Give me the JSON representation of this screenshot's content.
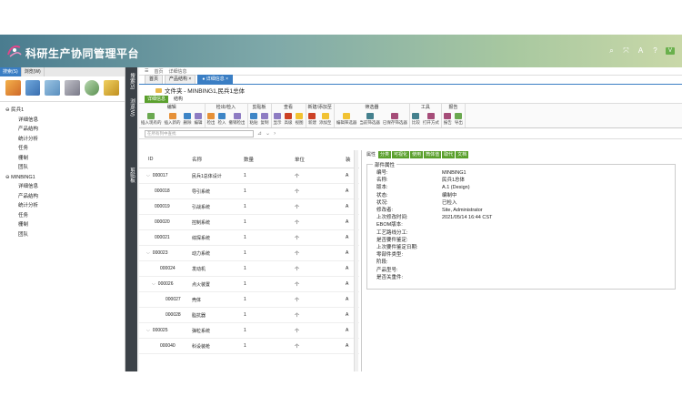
{
  "header": {
    "title": "科研生产协同管理平台",
    "user": "V"
  },
  "left": {
    "tabs": [
      "搜索(S)",
      "浏览(W)"
    ],
    "tree": [
      {
        "label": "⊖ 民兵1",
        "level": 0
      },
      {
        "label": "详细信息",
        "level": 2
      },
      {
        "label": "产品结构",
        "level": 2
      },
      {
        "label": "统计分析",
        "level": 2
      },
      {
        "label": "任务",
        "level": 2
      },
      {
        "label": "栅制",
        "level": 2
      },
      {
        "label": "团队",
        "level": 2
      },
      {
        "label": "⊖ MINBING1",
        "level": 0
      },
      {
        "label": "详细信息",
        "level": 2
      },
      {
        "label": "产品结构",
        "level": 2
      },
      {
        "label": "统计分析",
        "level": 2
      },
      {
        "label": "任务",
        "level": 2
      },
      {
        "label": "栅制",
        "level": 2
      },
      {
        "label": "团队",
        "level": 2
      }
    ]
  },
  "vbar": {
    "labels": [
      "搜索(S)",
      "浏览(W)",
      "剪贴板"
    ]
  },
  "main": {
    "top": [
      "首页",
      "详细信息"
    ],
    "tabs": [
      "首页",
      "产品结构 ×",
      "● 详细信息 ×"
    ],
    "breadcrumb": "文件夹 - MINBING1,民兵1总体",
    "subtabs": [
      "详细信息",
      "结构"
    ],
    "ribbon": [
      {
        "title": "编辑",
        "items": [
          "插入现有的",
          "插入新的",
          "删除",
          "编辑"
        ]
      },
      {
        "title": "检出/检入",
        "items": [
          "检出",
          "检入",
          "撤销检出"
        ]
      },
      {
        "title": "剪贴板",
        "items": [
          "粘贴",
          "复制"
        ]
      },
      {
        "title": "查看",
        "items": [
          "显示",
          "高级",
          "视图"
        ]
      },
      {
        "title": "新建/添加至",
        "items": [
          "新建",
          "添加至"
        ]
      },
      {
        "title": "筛选器",
        "items": [
          "编辑筛选器",
          "当前筛选器",
          "已保存筛选器"
        ]
      },
      {
        "title": "工具",
        "items": [
          "比较",
          "打开方式"
        ]
      },
      {
        "title": "报告",
        "items": [
          "报告",
          "导出"
        ]
      }
    ],
    "search_placeholder": "在所有列中查找",
    "table": {
      "headers": [
        "ID",
        "名称",
        "数量",
        "单位",
        "装"
      ],
      "rows": [
        {
          "id": "000017",
          "name": "民兵1总体设计",
          "qty": "1",
          "unit": "个",
          "ex": "A",
          "indent": 0,
          "caret": "⌵"
        },
        {
          "id": "000018",
          "name": "导引系统",
          "qty": "1",
          "unit": "个",
          "ex": "A",
          "indent": 1,
          "caret": ""
        },
        {
          "id": "000019",
          "name": "引战系统",
          "qty": "1",
          "unit": "个",
          "ex": "A",
          "indent": 1,
          "caret": ""
        },
        {
          "id": "000020",
          "name": "控制系统",
          "qty": "1",
          "unit": "个",
          "ex": "A",
          "indent": 1,
          "caret": ""
        },
        {
          "id": "000021",
          "name": "综探系统",
          "qty": "1",
          "unit": "个",
          "ex": "A",
          "indent": 1,
          "caret": ""
        },
        {
          "id": "000023",
          "name": "动力系统",
          "qty": "1",
          "unit": "个",
          "ex": "A",
          "indent": 0,
          "caret": "⌵"
        },
        {
          "id": "000024",
          "name": "发动机",
          "qty": "1",
          "unit": "个",
          "ex": "A",
          "indent": 2,
          "caret": ""
        },
        {
          "id": "000026",
          "name": "点火装置",
          "qty": "1",
          "unit": "个",
          "ex": "A",
          "indent": 1,
          "caret": "⌵"
        },
        {
          "id": "000027",
          "name": "壳体",
          "qty": "1",
          "unit": "个",
          "ex": "A",
          "indent": 3,
          "caret": ""
        },
        {
          "id": "000028",
          "name": "脂抗器",
          "qty": "1",
          "unit": "个",
          "ex": "A",
          "indent": 3,
          "caret": ""
        },
        {
          "id": "000025",
          "name": "弹粒系统",
          "qty": "1",
          "unit": "个",
          "ex": "A",
          "indent": 0,
          "caret": "⌵"
        },
        {
          "id": "000040",
          "name": "科设装枪",
          "qty": "1",
          "unit": "个",
          "ex": "A",
          "indent": 2,
          "caret": ""
        }
      ]
    },
    "props": {
      "tabs": [
        "属性",
        "分类",
        "可视化",
        "使用",
        "筒体值",
        "取代",
        "文档"
      ],
      "box_title": "部件属性",
      "fields": [
        {
          "label": "编号:",
          "value": "MINBING1"
        },
        {
          "label": "名称:",
          "value": "民兵1总体"
        },
        {
          "label": "版本:",
          "value": "A.1 (Design)"
        },
        {
          "label": "状态:",
          "value": "编制中"
        },
        {
          "label": "状况:",
          "value": "已检入"
        },
        {
          "label": "修改者:",
          "value": "Site, Administrator"
        },
        {
          "label": "上次修改时间:",
          "value": "2021/05/14 16:44 CST"
        },
        {
          "label": "EBOM版本:",
          "value": ""
        },
        {
          "label": "工艺路线分工:",
          "value": ""
        },
        {
          "label": "是否要件鉴定:",
          "value": ""
        },
        {
          "label": "上次要件鉴定日期:",
          "value": ""
        },
        {
          "label": "零部件类型:",
          "value": ""
        },
        {
          "label": "阶段:",
          "value": ""
        },
        {
          "label": "产品型号:",
          "value": ""
        },
        {
          "label": "是否关重件:",
          "value": ""
        }
      ]
    }
  },
  "colors": {
    "accent": "#3a7ec4",
    "green": "#5aa02c",
    "sidebar_dark": "#3c4248"
  }
}
